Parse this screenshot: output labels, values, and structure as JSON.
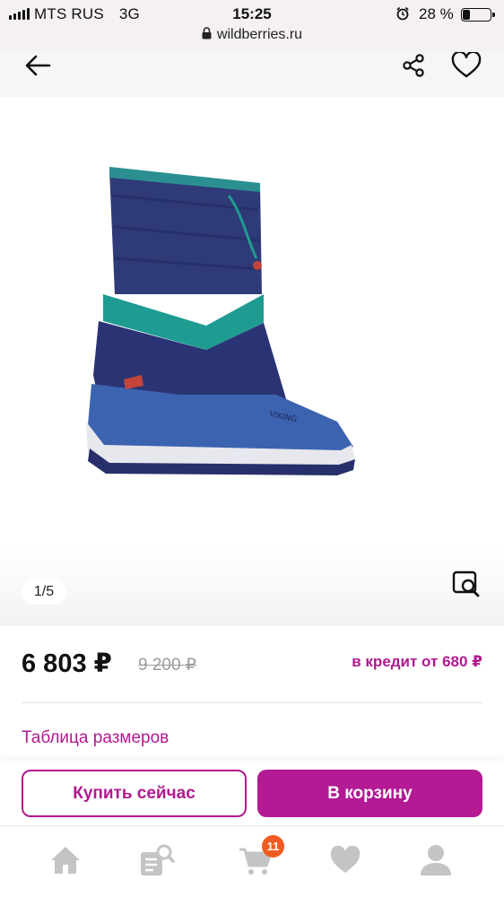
{
  "status_bar": {
    "carrier": "MTS RUS",
    "network": "3G",
    "time": "15:25",
    "battery_percent": "28 %",
    "battery_level": 0.28,
    "url": "wildberries.ru"
  },
  "nav": {
    "back_icon": "arrow-left-icon",
    "share_icon": "share-icon",
    "favorite_icon": "heart-outline-icon"
  },
  "gallery": {
    "pager": "1/5",
    "zoom_icon": "image-search-icon"
  },
  "price": {
    "current": "6 803 ₽",
    "old": "9 200 ₽",
    "credit": "в кредит от 680 ₽"
  },
  "size_table_link": "Таблица размеров",
  "actions": {
    "buy_now": "Купить сейчас",
    "to_cart": "В корзину"
  },
  "tabbar": {
    "items": [
      {
        "icon": "home-icon"
      },
      {
        "icon": "catalog-search-icon"
      },
      {
        "icon": "cart-icon",
        "badge": "11"
      },
      {
        "icon": "heart-icon"
      },
      {
        "icon": "profile-icon"
      }
    ]
  },
  "colors": {
    "brand": "#b2198f",
    "badge": "#f25c22",
    "tab_icon": "#c4c4c4"
  }
}
